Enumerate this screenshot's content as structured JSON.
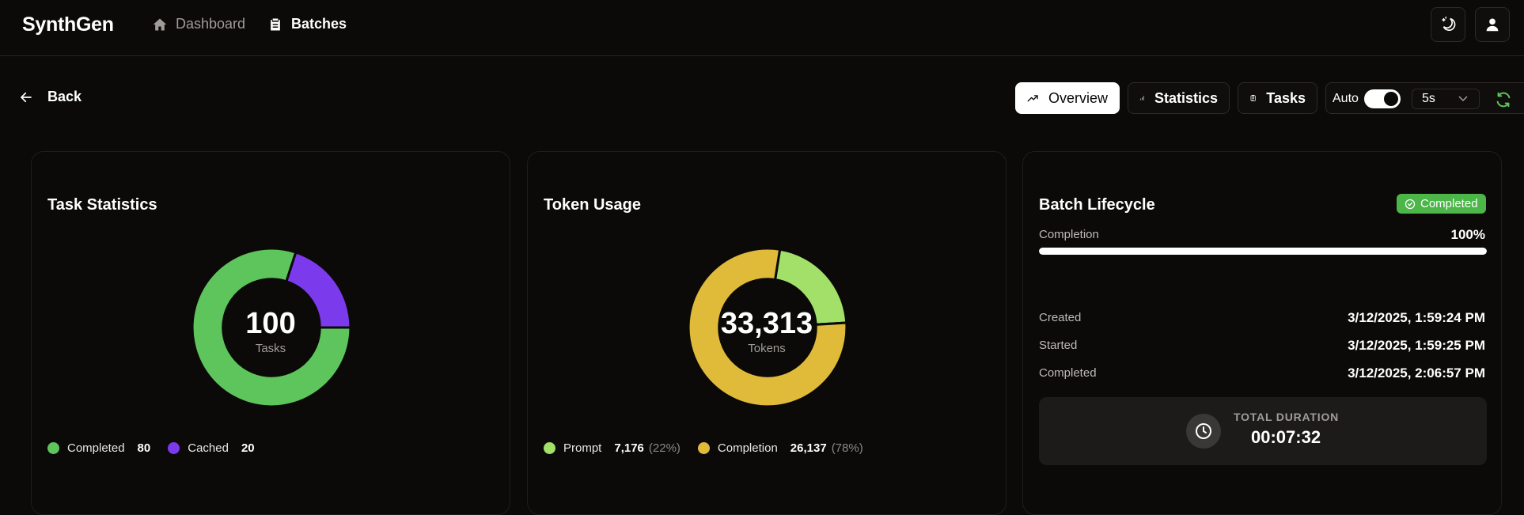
{
  "app": {
    "brand": "SynthGen"
  },
  "nav": {
    "dashboard": "Dashboard",
    "batches": "Batches"
  },
  "header_icons": [
    "theme-toggle-icon",
    "user-icon"
  ],
  "toolbar": {
    "back_label": "Back",
    "tabs": [
      {
        "label": "Overview",
        "icon": "trending-up-icon",
        "active": true
      },
      {
        "label": "Statistics",
        "icon": "bar-chart-icon",
        "active": false
      },
      {
        "label": "Tasks",
        "icon": "clipboard-list-icon",
        "active": false
      }
    ],
    "auto_label": "Auto",
    "auto_enabled": true,
    "interval": "5s"
  },
  "task_stats": {
    "title": "Task Statistics",
    "center_value": "100",
    "center_label": "Tasks",
    "legend": [
      {
        "label": "Completed",
        "value": "80",
        "color": "#5ec45c"
      },
      {
        "label": "Cached",
        "value": "20",
        "color": "#7c3aed"
      }
    ]
  },
  "token_usage": {
    "title": "Token Usage",
    "center_value": "33,313",
    "center_label": "Tokens",
    "legend": [
      {
        "label": "Prompt",
        "value": "7,176",
        "pct": "(22%)",
        "color": "#a3e06a"
      },
      {
        "label": "Completion",
        "value": "26,137",
        "pct": "(78%)",
        "color": "#e0bb3a"
      }
    ]
  },
  "lifecycle": {
    "title": "Batch Lifecycle",
    "status_badge": "Completed",
    "completion_label": "Completion",
    "completion_value": "100%",
    "completion_fraction": 1.0,
    "created_label": "Created",
    "created_value": "3/12/2025, 1:59:24 PM",
    "started_label": "Started",
    "started_value": "3/12/2025, 1:59:25 PM",
    "completed_label": "Completed",
    "completed_value": "3/12/2025, 2:06:57 PM",
    "duration_label": "TOTAL DURATION",
    "duration_value": "00:07:32"
  },
  "chart_data": [
    {
      "type": "pie",
      "title": "Task Statistics",
      "categories": [
        "Completed",
        "Cached"
      ],
      "values": [
        80,
        20
      ],
      "colors": [
        "#5ec45c",
        "#7c3aed"
      ],
      "total": 100
    },
    {
      "type": "pie",
      "title": "Token Usage",
      "categories": [
        "Prompt",
        "Completion"
      ],
      "values": [
        7176,
        26137
      ],
      "colors": [
        "#a3e06a",
        "#e0bb3a"
      ],
      "total": 33313
    }
  ]
}
